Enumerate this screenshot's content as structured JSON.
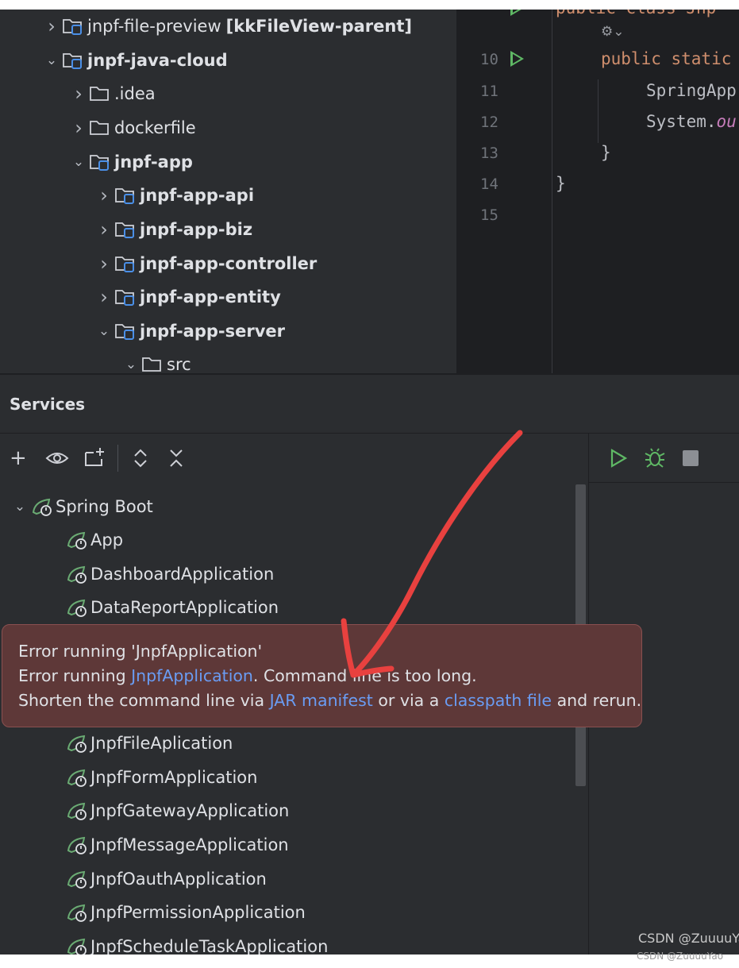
{
  "project_tree": {
    "items": [
      {
        "label": "jnpf-file-preview",
        "suffix": "[kkFileView-parent]",
        "expanded": false,
        "module": true,
        "bold": false
      },
      {
        "label": "jnpf-java-cloud",
        "expanded": true,
        "module": true,
        "bold": true
      },
      {
        "label": ".idea",
        "expanded": false,
        "module": false,
        "bold": false
      },
      {
        "label": "dockerfile",
        "expanded": false,
        "module": false,
        "bold": false
      },
      {
        "label": "jnpf-app",
        "expanded": true,
        "module": true,
        "bold": true
      },
      {
        "label": "jnpf-app-api",
        "expanded": false,
        "module": true,
        "bold": true
      },
      {
        "label": "jnpf-app-biz",
        "expanded": false,
        "module": true,
        "bold": true
      },
      {
        "label": "jnpf-app-controller",
        "expanded": false,
        "module": true,
        "bold": true
      },
      {
        "label": "jnpf-app-entity",
        "expanded": false,
        "module": true,
        "bold": true
      },
      {
        "label": "jnpf-app-server",
        "expanded": true,
        "module": true,
        "bold": true
      },
      {
        "label": "src",
        "expanded": true,
        "module": false,
        "bold": false
      }
    ]
  },
  "editor": {
    "line_numbers": [
      "10",
      "11",
      "12",
      "13",
      "14",
      "15"
    ],
    "top_line": "public class Jnp",
    "lines": {
      "l10_kw": "public static",
      "l11": "SpringApp",
      "l12_a": "System.",
      "l12_b": "ou",
      "l13": "}",
      "l14": "}"
    }
  },
  "services": {
    "title": "Services",
    "group_label": "Spring Boot",
    "items": [
      "App",
      "DashboardApplication",
      "DataReportApplication",
      "JnpfFileAplication",
      "JnpfFormApplication",
      "JnpfGatewayApplication",
      "JnpfMessageApplication",
      "JnpfOauthApplication",
      "JnpfPermissionApplication",
      "JnpfScheduleTaskApplication"
    ]
  },
  "error_balloon": {
    "title": "Error running 'JnpfApplication'",
    "line2_prefix": "Error running ",
    "line2_link": "JnpfApplication",
    "line2_suffix": ". Command line is too long.",
    "line3_prefix": "Shorten the command line via ",
    "line3_link1": "JAR manifest",
    "line3_mid": " or via a ",
    "line3_link2": "classpath file",
    "line3_suffix": " and rerun."
  },
  "watermark": {
    "main": "CSDN @ZuuuuYa",
    "small": "CSDN @ZuuuuYao"
  },
  "colors": {
    "panel_bg": "#2b2d30",
    "editor_bg": "#1e1f22",
    "error_bg": "#5e3838",
    "link": "#6a9cf3",
    "run_green": "#5fb865",
    "spring_green": "#6aab73",
    "annotation_red": "#e8413f"
  }
}
